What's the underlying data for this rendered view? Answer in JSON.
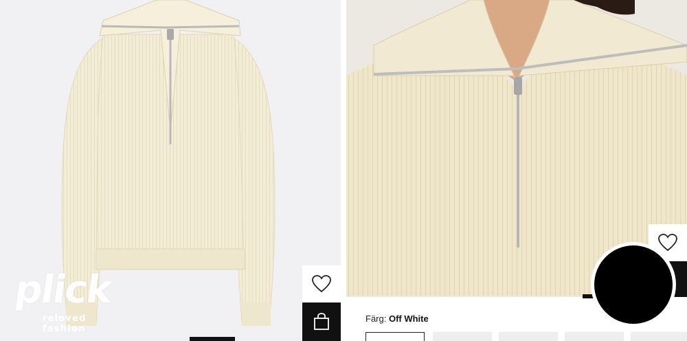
{
  "product": {
    "color_label": "Färg:",
    "color_value": "Off White",
    "swatch_count": 5,
    "selected_swatch": 0
  },
  "brand": {
    "logo_word": "plick",
    "tagline": "reloved fashion"
  },
  "icons": {
    "wishlist": "heart-icon",
    "bag": "shopping-bag-icon"
  },
  "colors": {
    "sweater": "#f3ecd6",
    "background_left": "#f1f1f3",
    "zipper": "#b9b9b9",
    "bag_button": "#111111"
  }
}
